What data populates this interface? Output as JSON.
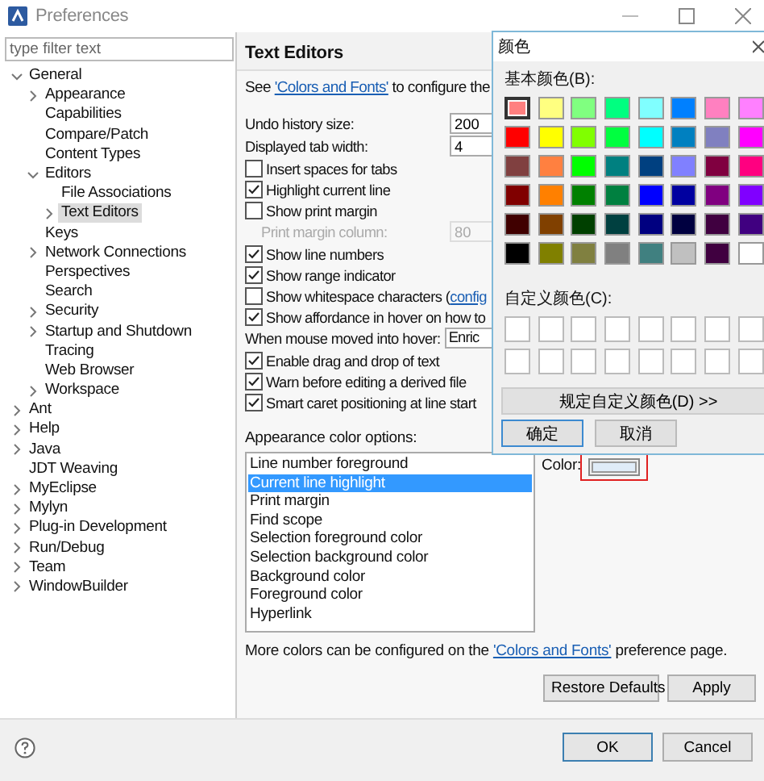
{
  "window": {
    "title": "Preferences"
  },
  "sidebar": {
    "filter": {
      "placeholder": "type filter text"
    },
    "items": [
      {
        "label": "General",
        "expanded": true,
        "selected": false,
        "children": [
          {
            "label": "Appearance",
            "expanded": false,
            "selected": false
          },
          {
            "label": "Capabilities",
            "selected": false
          },
          {
            "label": "Compare/Patch",
            "selected": false
          },
          {
            "label": "Content Types",
            "selected": false
          },
          {
            "label": "Editors",
            "expanded": true,
            "selected": false,
            "children": [
              {
                "label": "File Associations",
                "selected": false
              },
              {
                "label": "Text Editors",
                "expanded": false,
                "selected": true
              }
            ]
          },
          {
            "label": "Keys",
            "selected": false
          },
          {
            "label": "Network Connections",
            "expanded": false,
            "selected": false
          },
          {
            "label": "Perspectives",
            "selected": false
          },
          {
            "label": "Search",
            "selected": false
          },
          {
            "label": "Security",
            "expanded": false,
            "selected": false
          },
          {
            "label": "Startup and Shutdown",
            "expanded": false,
            "selected": false
          },
          {
            "label": "Tracing",
            "selected": false
          },
          {
            "label": "Web Browser",
            "selected": false
          },
          {
            "label": "Workspace",
            "expanded": false,
            "selected": false
          }
        ]
      },
      {
        "label": "Ant",
        "expanded": false,
        "selected": false
      },
      {
        "label": "Help",
        "expanded": false,
        "selected": false
      },
      {
        "label": "Java",
        "expanded": false,
        "selected": false
      },
      {
        "label": "JDT Weaving",
        "selected": false
      },
      {
        "label": "MyEclipse",
        "expanded": false,
        "selected": false
      },
      {
        "label": "Mylyn",
        "expanded": false,
        "selected": false
      },
      {
        "label": "Plug-in Development",
        "expanded": false,
        "selected": false
      },
      {
        "label": "Run/Debug",
        "expanded": false,
        "selected": false
      },
      {
        "label": "Team",
        "expanded": false,
        "selected": false
      },
      {
        "label": "WindowBuilder",
        "expanded": false,
        "selected": false
      }
    ]
  },
  "page": {
    "title": "Text Editors",
    "intro": {
      "before": "See ",
      "link": "'Colors and Fonts'",
      "after": " to configure the"
    },
    "settings": [
      {
        "kind": "field",
        "label": "Undo history size:",
        "value": "200",
        "disabled": false
      },
      {
        "kind": "field",
        "label": "Displayed tab width:",
        "value": "4",
        "disabled": false
      },
      {
        "kind": "checkbox",
        "label": "Insert spaces for tabs",
        "checked": false
      },
      {
        "kind": "checkbox",
        "label": "Highlight current line",
        "checked": true
      },
      {
        "kind": "checkbox",
        "label": "Show print margin",
        "checked": false
      },
      {
        "kind": "field",
        "label": "Print margin column:",
        "value": "80",
        "disabled": true
      },
      {
        "kind": "checkbox",
        "label": "Show line numbers",
        "checked": true
      },
      {
        "kind": "checkbox",
        "label": "Show range indicator",
        "checked": true
      },
      {
        "kind": "checkbox",
        "label": "Show whitespace characters (",
        "link": "config",
        "checked": false
      },
      {
        "kind": "checkbox",
        "label": "Show affordance in hover on how to",
        "checked": true
      },
      {
        "kind": "dropdown",
        "label": "When mouse moved into hover:",
        "value": "Enric"
      },
      {
        "kind": "checkbox",
        "label": "Enable drag and drop of text",
        "checked": true
      },
      {
        "kind": "checkbox",
        "label": "Warn before editing a derived file",
        "checked": true
      },
      {
        "kind": "checkbox",
        "label": "Smart caret positioning at line start",
        "checked": true
      }
    ],
    "color_options": {
      "label": "Appearance color options:",
      "items": [
        {
          "label": "Line number foreground",
          "selected": false
        },
        {
          "label": "Current line highlight",
          "selected": true
        },
        {
          "label": "Print margin",
          "selected": false
        },
        {
          "label": "Find scope",
          "selected": false
        },
        {
          "label": "Selection foreground color",
          "selected": false
        },
        {
          "label": "Selection background color",
          "selected": false
        },
        {
          "label": "Background color",
          "selected": false
        },
        {
          "label": "Foreground color",
          "selected": false
        },
        {
          "label": "Hyperlink",
          "selected": false
        }
      ],
      "color_label": "Color:"
    },
    "footer_note": {
      "before": "More colors can be configured on the ",
      "link": "'Colors and Fonts'",
      "after": " preference page."
    },
    "buttons": [
      "Restore Defaults",
      "Apply"
    ]
  },
  "dialog_buttons": [
    "OK",
    "Cancel"
  ],
  "color_dialog": {
    "title": "颜色",
    "basic_label": "基本颜色(B):",
    "basic_colors": [
      {
        "color": "#ff8080",
        "selected": true
      },
      {
        "color": "#ffff80",
        "selected": false
      },
      {
        "color": "#80ff80",
        "selected": false
      },
      {
        "color": "#00ff80",
        "selected": false
      },
      {
        "color": "#80ffff",
        "selected": false
      },
      {
        "color": "#0080ff",
        "selected": false
      },
      {
        "color": "#ff80c0",
        "selected": false
      },
      {
        "color": "#ff80ff",
        "selected": false
      },
      {
        "color": "#ff0000",
        "selected": false
      },
      {
        "color": "#ffff00",
        "selected": false
      },
      {
        "color": "#80ff00",
        "selected": false
      },
      {
        "color": "#00ff40",
        "selected": false
      },
      {
        "color": "#00ffff",
        "selected": false
      },
      {
        "color": "#0080c0",
        "selected": false
      },
      {
        "color": "#8080c0",
        "selected": false
      },
      {
        "color": "#ff00ff",
        "selected": false
      },
      {
        "color": "#804040",
        "selected": false
      },
      {
        "color": "#ff8040",
        "selected": false
      },
      {
        "color": "#00ff00",
        "selected": false
      },
      {
        "color": "#008080",
        "selected": false
      },
      {
        "color": "#004080",
        "selected": false
      },
      {
        "color": "#8080ff",
        "selected": false
      },
      {
        "color": "#800040",
        "selected": false
      },
      {
        "color": "#ff0080",
        "selected": false
      },
      {
        "color": "#800000",
        "selected": false
      },
      {
        "color": "#ff8000",
        "selected": false
      },
      {
        "color": "#008000",
        "selected": false
      },
      {
        "color": "#008040",
        "selected": false
      },
      {
        "color": "#0000ff",
        "selected": false
      },
      {
        "color": "#0000a0",
        "selected": false
      },
      {
        "color": "#800080",
        "selected": false
      },
      {
        "color": "#8000ff",
        "selected": false
      },
      {
        "color": "#400000",
        "selected": false
      },
      {
        "color": "#804000",
        "selected": false
      },
      {
        "color": "#004000",
        "selected": false
      },
      {
        "color": "#004040",
        "selected": false
      },
      {
        "color": "#000080",
        "selected": false
      },
      {
        "color": "#000040",
        "selected": false
      },
      {
        "color": "#400040",
        "selected": false
      },
      {
        "color": "#400080",
        "selected": false
      },
      {
        "color": "#000000",
        "selected": false
      },
      {
        "color": "#808000",
        "selected": false
      },
      {
        "color": "#808040",
        "selected": false
      },
      {
        "color": "#808080",
        "selected": false
      },
      {
        "color": "#408080",
        "selected": false
      },
      {
        "color": "#c0c0c0",
        "selected": false
      },
      {
        "color": "#400040",
        "selected": false
      },
      {
        "color": "#ffffff",
        "selected": false
      }
    ],
    "custom_label": "自定义颜色(C):",
    "define_button": "规定自定义颜色(D) >>",
    "buttons": [
      "确定",
      "取消"
    ]
  }
}
